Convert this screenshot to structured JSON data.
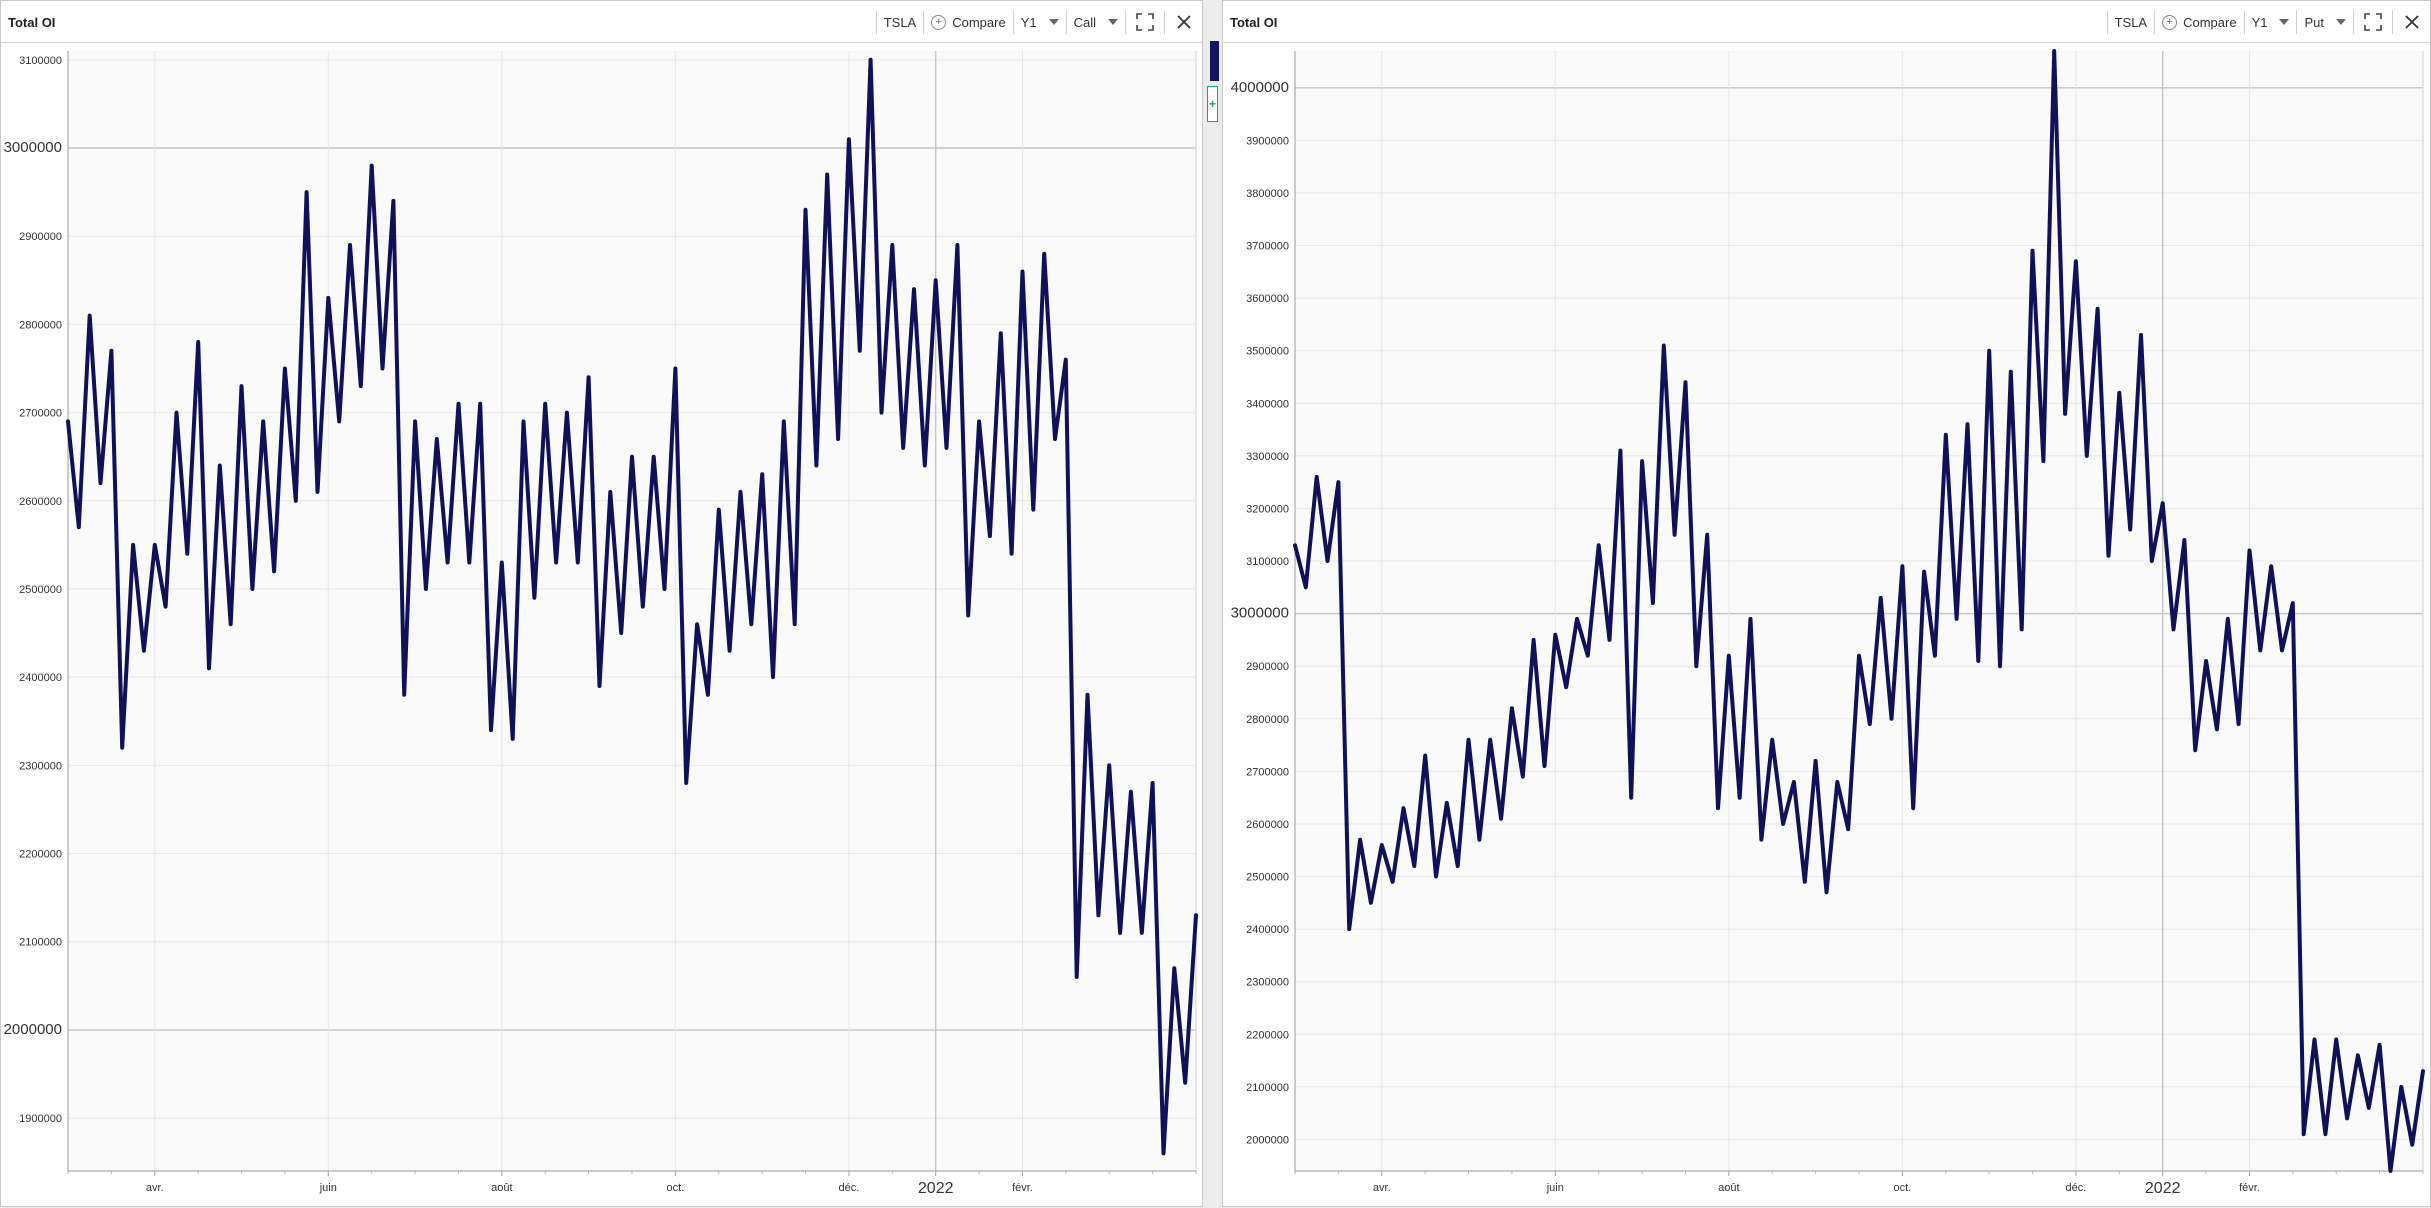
{
  "colors": {
    "line": "#13105a",
    "grid": "#e8e8e8",
    "major_grid": "#c6c6c6",
    "plot_bg": "#fafafa",
    "axis_text": "#333333",
    "accent": "#1aa37a"
  },
  "left_panel": {
    "title": "Total OI",
    "ticker": "TSLA",
    "compare_label": "Compare",
    "range": "Y1",
    "option_type": "Call"
  },
  "right_panel": {
    "title": "Total OI",
    "ticker": "TSLA",
    "compare_label": "Compare",
    "range": "Y1",
    "option_type": "Put"
  },
  "icons": {
    "compare": "plus-circle-icon",
    "expand": "expand-icon",
    "close": "close-icon",
    "dropdown": "chevron-down-icon",
    "add": "plus-icon"
  },
  "chart_data": [
    {
      "type": "line",
      "title": "Total OI",
      "series": [
        {
          "values": [
            2690000,
            2570000,
            2810000,
            2620000,
            2770000,
            2320000,
            2550000,
            2430000,
            2550000,
            2480000,
            2700000,
            2540000,
            2780000,
            2410000,
            2640000,
            2460000,
            2730000,
            2500000,
            2690000,
            2520000,
            2750000,
            2600000,
            2950000,
            2610000,
            2830000,
            2690000,
            2890000,
            2730000,
            2980000,
            2750000,
            2940000,
            2380000,
            2690000,
            2500000,
            2670000,
            2530000,
            2710000,
            2530000,
            2710000,
            2340000,
            2530000,
            2330000,
            2690000,
            2490000,
            2710000,
            2530000,
            2700000,
            2530000,
            2740000,
            2390000,
            2610000,
            2450000,
            2650000,
            2480000,
            2650000,
            2500000,
            2750000,
            2280000,
            2460000,
            2380000,
            2590000,
            2430000,
            2610000,
            2460000,
            2630000,
            2400000,
            2690000,
            2460000,
            2930000,
            2640000,
            2970000,
            2670000,
            3010000,
            2770000,
            3100000,
            2700000,
            2890000,
            2660000,
            2840000,
            2640000,
            2850000,
            2660000,
            2890000,
            2470000,
            2690000,
            2560000,
            2790000,
            2540000,
            2860000,
            2590000,
            2880000,
            2670000,
            2760000,
            2060000,
            2380000,
            2130000,
            2300000,
            2110000,
            2270000,
            2110000,
            2280000,
            1860000,
            2070000,
            1940000,
            2130000
          ]
        }
      ],
      "x_tick_labels": [
        "avr.",
        "juin",
        "août",
        "oct.",
        "déc.",
        "2022",
        "févr."
      ],
      "x_tick_positions": [
        8,
        24,
        40,
        56,
        72,
        80,
        88
      ],
      "y_tick_labels": [
        "1900000",
        "2000000",
        "2100000",
        "2200000",
        "2300000",
        "2400000",
        "2500000",
        "2600000",
        "2700000",
        "2800000",
        "2900000",
        "3000000",
        "3100000"
      ],
      "y_major_labels": [
        "2000000",
        "3000000"
      ],
      "ylim": [
        1840000,
        3110000
      ],
      "grid": true
    },
    {
      "type": "line",
      "title": "Total OI",
      "series": [
        {
          "values": [
            3130000,
            3050000,
            3260000,
            3100000,
            3250000,
            2400000,
            2570000,
            2450000,
            2560000,
            2490000,
            2630000,
            2520000,
            2730000,
            2500000,
            2640000,
            2520000,
            2760000,
            2570000,
            2760000,
            2610000,
            2820000,
            2690000,
            2950000,
            2710000,
            2960000,
            2860000,
            2990000,
            2920000,
            3130000,
            2950000,
            3310000,
            2650000,
            3290000,
            3020000,
            3510000,
            3150000,
            3440000,
            2900000,
            3150000,
            2630000,
            2920000,
            2650000,
            2990000,
            2570000,
            2760000,
            2600000,
            2680000,
            2490000,
            2720000,
            2470000,
            2680000,
            2590000,
            2920000,
            2790000,
            3030000,
            2800000,
            3090000,
            2630000,
            3080000,
            2920000,
            3340000,
            2990000,
            3360000,
            2910000,
            3500000,
            2900000,
            3460000,
            2970000,
            3690000,
            3290000,
            4070000,
            3380000,
            3670000,
            3300000,
            3580000,
            3110000,
            3420000,
            3160000,
            3530000,
            3100000,
            3210000,
            2970000,
            3140000,
            2740000,
            2910000,
            2780000,
            2990000,
            2790000,
            3120000,
            2930000,
            3090000,
            2930000,
            3020000,
            2010000,
            2190000,
            2010000,
            2190000,
            2040000,
            2160000,
            2060000,
            2180000,
            1940000,
            2100000,
            1990000,
            2130000
          ]
        }
      ],
      "x_tick_labels": [
        "avr.",
        "juin",
        "août",
        "oct.",
        "déc.",
        "2022",
        "févr."
      ],
      "x_tick_positions": [
        8,
        24,
        40,
        56,
        72,
        80,
        88
      ],
      "y_tick_labels": [
        "2000000",
        "2100000",
        "2200000",
        "2300000",
        "2400000",
        "2500000",
        "2600000",
        "2700000",
        "2800000",
        "2900000",
        "3000000",
        "3100000",
        "3200000",
        "3300000",
        "3400000",
        "3500000",
        "3600000",
        "3700000",
        "3800000",
        "3900000",
        "4000000"
      ],
      "y_major_labels": [
        "3000000",
        "4000000"
      ],
      "ylim": [
        1940000,
        4070000
      ],
      "grid": true
    }
  ]
}
